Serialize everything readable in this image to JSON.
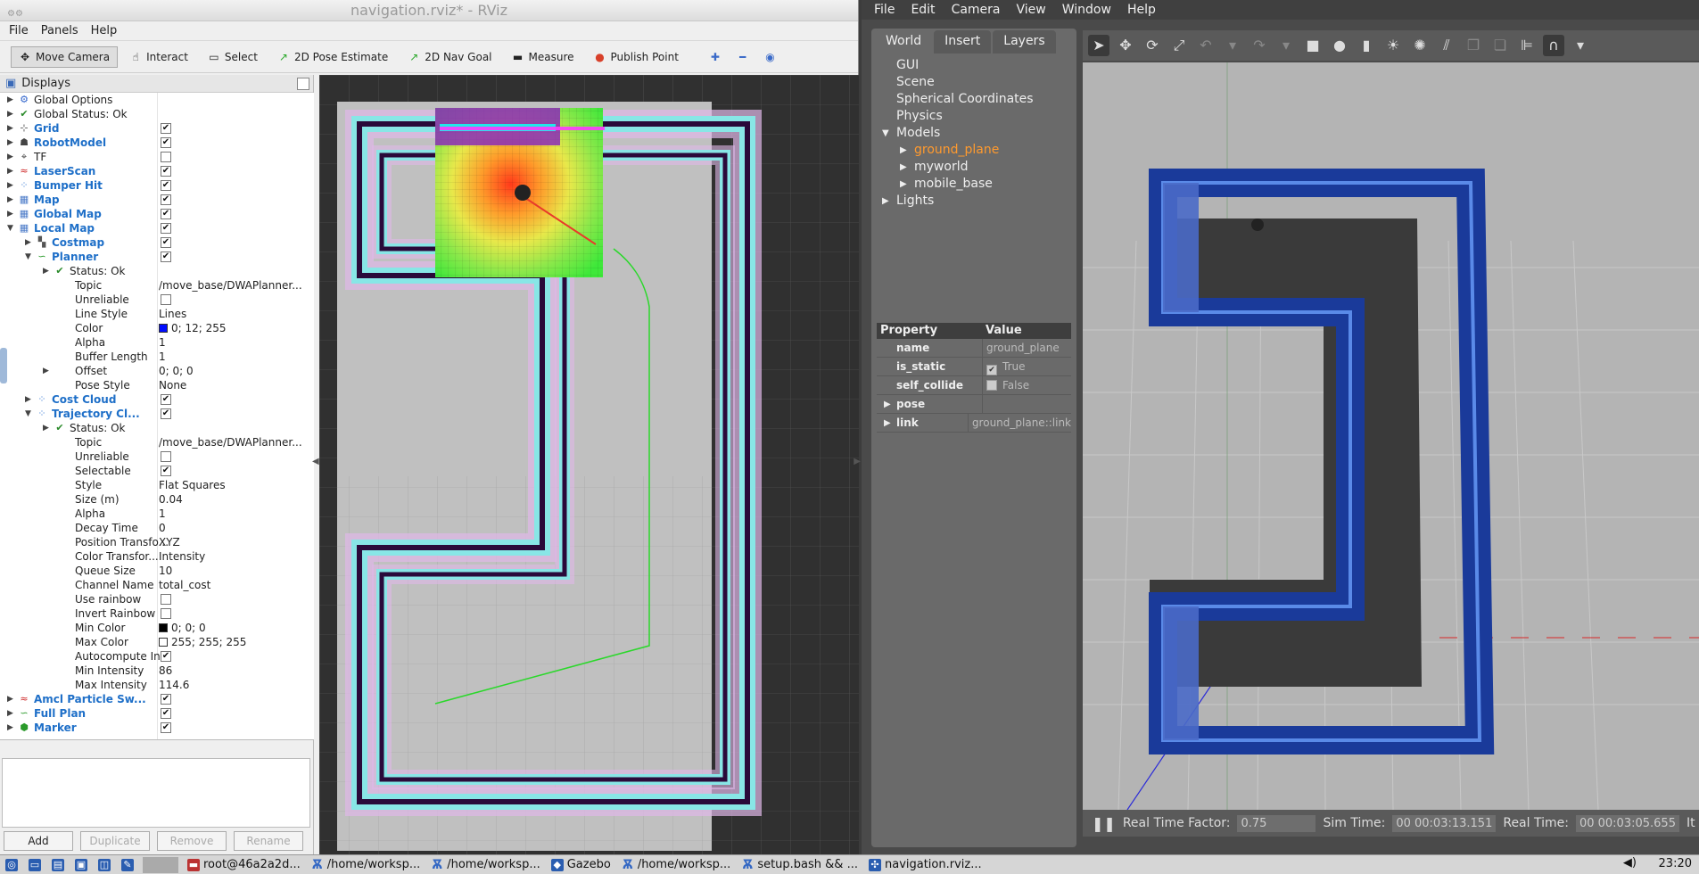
{
  "rviz": {
    "title": "navigation.rviz* - RViz",
    "menu": [
      "File",
      "Panels",
      "Help"
    ],
    "tools": [
      {
        "label": "Move Camera",
        "icon": "move-camera-icon",
        "glyph": "✥"
      },
      {
        "label": "Interact",
        "icon": "hand-icon",
        "glyph": "☝"
      },
      {
        "label": "Select",
        "icon": "select-icon",
        "glyph": "▭"
      },
      {
        "label": "2D Pose Estimate",
        "icon": "pose-arrow-icon",
        "glyph": "↗"
      },
      {
        "label": "2D Nav Goal",
        "icon": "goal-arrow-icon",
        "glyph": "↗"
      },
      {
        "label": "Measure",
        "icon": "ruler-icon",
        "glyph": "▬"
      },
      {
        "label": "Publish Point",
        "icon": "pin-icon",
        "glyph": "●"
      }
    ],
    "displays_title": "Displays",
    "tree": [
      {
        "indent": 0,
        "arrow": "▶",
        "icon": "⚙",
        "iconColor": "#3366cc",
        "name": "Global Options",
        "top": false
      },
      {
        "indent": 0,
        "arrow": "▶",
        "icon": "✔",
        "iconColor": "#2a8a2a",
        "name": "Global Status: Ok",
        "top": false
      },
      {
        "indent": 0,
        "arrow": "▶",
        "icon": "⊹",
        "iconColor": "#555",
        "name": "Grid",
        "top": true,
        "check": "✔"
      },
      {
        "indent": 0,
        "arrow": "▶",
        "icon": "☗",
        "iconColor": "#444",
        "name": "RobotModel",
        "top": true,
        "check": "✔"
      },
      {
        "indent": 0,
        "arrow": "▶",
        "icon": "⌖",
        "iconColor": "#444",
        "name": "TF",
        "top": false,
        "check": ""
      },
      {
        "indent": 0,
        "arrow": "▶",
        "icon": "≈",
        "iconColor": "#c22",
        "name": "LaserScan",
        "top": true,
        "check": "✔"
      },
      {
        "indent": 0,
        "arrow": "▶",
        "icon": "⁘",
        "iconColor": "#3a7bd5",
        "name": "Bumper Hit",
        "top": true,
        "check": "✔"
      },
      {
        "indent": 0,
        "arrow": "▶",
        "icon": "▦",
        "iconColor": "#4a7ac8",
        "name": "Map",
        "top": true,
        "check": "✔"
      },
      {
        "indent": 0,
        "arrow": "▶",
        "icon": "▦",
        "iconColor": "#4a7ac8",
        "name": "Global Map",
        "top": true,
        "check": "✔"
      },
      {
        "indent": 0,
        "arrow": "▼",
        "icon": "▦",
        "iconColor": "#4a7ac8",
        "name": "Local Map",
        "top": true,
        "check": "✔"
      },
      {
        "indent": 1,
        "arrow": "▶",
        "icon": "▚",
        "iconColor": "#555",
        "name": "Costmap",
        "top": true,
        "check": "✔"
      },
      {
        "indent": 1,
        "arrow": "▼",
        "icon": "∽",
        "iconColor": "#2a9a2a",
        "name": "Planner",
        "top": true,
        "check": "✔"
      },
      {
        "indent": 2,
        "arrow": "▶",
        "icon": "✔",
        "iconColor": "#2a8a2a",
        "name": "Status: Ok",
        "top": false
      },
      {
        "indent": 2,
        "arrow": "",
        "icon": "",
        "name": "Topic",
        "top": false,
        "value": "/move_base/DWAPlanner..."
      },
      {
        "indent": 2,
        "arrow": "",
        "icon": "",
        "name": "Unreliable",
        "top": false,
        "check": ""
      },
      {
        "indent": 2,
        "arrow": "",
        "icon": "",
        "name": "Line Style",
        "top": false,
        "value": "Lines"
      },
      {
        "indent": 2,
        "arrow": "",
        "icon": "",
        "name": "Color",
        "top": false,
        "value": "0; 12; 255",
        "swatch": "#000cff"
      },
      {
        "indent": 2,
        "arrow": "",
        "icon": "",
        "name": "Alpha",
        "top": false,
        "value": "1"
      },
      {
        "indent": 2,
        "arrow": "",
        "icon": "",
        "name": "Buffer Length",
        "top": false,
        "value": "1"
      },
      {
        "indent": 2,
        "arrow": "▶",
        "icon": "",
        "name": "Offset",
        "top": false,
        "value": "0; 0; 0"
      },
      {
        "indent": 2,
        "arrow": "",
        "icon": "",
        "name": "Pose Style",
        "top": false,
        "value": "None"
      },
      {
        "indent": 1,
        "arrow": "▶",
        "icon": "⁘",
        "iconColor": "#3a7bd5",
        "name": "Cost Cloud",
        "top": true,
        "check": "✔"
      },
      {
        "indent": 1,
        "arrow": "▼",
        "icon": "⁘",
        "iconColor": "#3a7bd5",
        "name": "Trajectory Cl...",
        "top": true,
        "check": "✔"
      },
      {
        "indent": 2,
        "arrow": "▶",
        "icon": "✔",
        "iconColor": "#2a8a2a",
        "name": "Status: Ok",
        "top": false
      },
      {
        "indent": 2,
        "arrow": "",
        "icon": "",
        "name": "Topic",
        "top": false,
        "value": "/move_base/DWAPlanner..."
      },
      {
        "indent": 2,
        "arrow": "",
        "icon": "",
        "name": "Unreliable",
        "top": false,
        "check": ""
      },
      {
        "indent": 2,
        "arrow": "",
        "icon": "",
        "name": "Selectable",
        "top": false,
        "check": "✔"
      },
      {
        "indent": 2,
        "arrow": "",
        "icon": "",
        "name": "Style",
        "top": false,
        "value": "Flat Squares"
      },
      {
        "indent": 2,
        "arrow": "",
        "icon": "",
        "name": "Size (m)",
        "top": false,
        "value": "0.04"
      },
      {
        "indent": 2,
        "arrow": "",
        "icon": "",
        "name": "Alpha",
        "top": false,
        "value": "1"
      },
      {
        "indent": 2,
        "arrow": "",
        "icon": "",
        "name": "Decay Time",
        "top": false,
        "value": "0"
      },
      {
        "indent": 2,
        "arrow": "",
        "icon": "",
        "name": "Position Transfo...",
        "top": false,
        "value": "XYZ"
      },
      {
        "indent": 2,
        "arrow": "",
        "icon": "",
        "name": "Color Transfor...",
        "top": false,
        "value": "Intensity"
      },
      {
        "indent": 2,
        "arrow": "",
        "icon": "",
        "name": "Queue Size",
        "top": false,
        "value": "10"
      },
      {
        "indent": 2,
        "arrow": "",
        "icon": "",
        "name": "Channel Name",
        "top": false,
        "value": "total_cost"
      },
      {
        "indent": 2,
        "arrow": "",
        "icon": "",
        "name": "Use rainbow",
        "top": false,
        "check": ""
      },
      {
        "indent": 2,
        "arrow": "",
        "icon": "",
        "name": "Invert Rainbow",
        "top": false,
        "check": ""
      },
      {
        "indent": 2,
        "arrow": "",
        "icon": "",
        "name": "Min Color",
        "top": false,
        "value": "0; 0; 0",
        "swatch": "#000000"
      },
      {
        "indent": 2,
        "arrow": "",
        "icon": "",
        "name": "Max Color",
        "top": false,
        "value": "255; 255; 255",
        "swatch": "#ffffff"
      },
      {
        "indent": 2,
        "arrow": "",
        "icon": "",
        "name": "Autocompute In...",
        "top": false,
        "check": "✔"
      },
      {
        "indent": 2,
        "arrow": "",
        "icon": "",
        "name": "Min Intensity",
        "top": false,
        "value": "86"
      },
      {
        "indent": 2,
        "arrow": "",
        "icon": "",
        "name": "Max Intensity",
        "top": false,
        "value": "114.6"
      },
      {
        "indent": 0,
        "arrow": "▶",
        "icon": "≈",
        "iconColor": "#c22",
        "name": "Amcl Particle Sw...",
        "top": true,
        "check": "✔"
      },
      {
        "indent": 0,
        "arrow": "▶",
        "icon": "∽",
        "iconColor": "#2a9a2a",
        "name": "Full Plan",
        "top": true,
        "check": "✔"
      },
      {
        "indent": 0,
        "arrow": "▶",
        "icon": "⬢",
        "iconColor": "#2a9a2a",
        "name": "Marker",
        "top": true,
        "check": "✔"
      }
    ],
    "buttons": {
      "add": "Add",
      "duplicate": "Duplicate",
      "remove": "Remove",
      "rename": "Rename"
    }
  },
  "gazebo": {
    "menu": [
      "File",
      "Edit",
      "Camera",
      "View",
      "Window",
      "Help"
    ],
    "tabs": [
      "World",
      "Insert",
      "Layers"
    ],
    "tree": [
      {
        "indent": 0,
        "arrow": "",
        "label": "GUI",
        "selected": false
      },
      {
        "indent": 0,
        "arrow": "",
        "label": "Scene",
        "selected": false
      },
      {
        "indent": 0,
        "arrow": "",
        "label": "Spherical Coordinates",
        "selected": false
      },
      {
        "indent": 0,
        "arrow": "",
        "label": "Physics",
        "selected": false
      },
      {
        "indent": 0,
        "arrow": "▼",
        "label": "Models",
        "selected": false
      },
      {
        "indent": 1,
        "arrow": "▶",
        "label": "ground_plane",
        "selected": true
      },
      {
        "indent": 1,
        "arrow": "▶",
        "label": "myworld",
        "selected": false
      },
      {
        "indent": 1,
        "arrow": "▶",
        "label": "mobile_base",
        "selected": false
      },
      {
        "indent": 0,
        "arrow": "▶",
        "label": "Lights",
        "selected": false
      }
    ],
    "props_header": {
      "property": "Property",
      "value": "Value"
    },
    "props": [
      {
        "key": "name",
        "value": "ground_plane",
        "arrow": "",
        "check": null
      },
      {
        "key": "is_static",
        "value": "True",
        "arrow": "",
        "check": "✔"
      },
      {
        "key": "self_collide",
        "value": "False",
        "arrow": "",
        "check": ""
      },
      {
        "key": "pose",
        "value": "",
        "arrow": "▶",
        "check": null
      },
      {
        "key": "link",
        "value": "ground_plane::link",
        "arrow": "▶",
        "check": null
      }
    ],
    "status": {
      "rtf_label": "Real Time Factor:",
      "rtf": "0.75",
      "sim_label": "Sim Time:",
      "sim": "00 00:03:13.151",
      "real_label": "Real Time:",
      "real": "00 00:03:05.655",
      "trail": "It"
    }
  },
  "taskbar": {
    "items": [
      {
        "label": "root@46a2a2d...",
        "icon": "terminal-icon",
        "glyph": "▬",
        "red": true
      },
      {
        "label": "/home/worksp...",
        "icon": "rviz-icon",
        "glyph": "Ѫ",
        "rviz": true
      },
      {
        "label": "/home/worksp...",
        "icon": "rviz-icon",
        "glyph": "Ѫ",
        "rviz": true
      },
      {
        "label": "Gazebo",
        "icon": "gazebo-icon",
        "glyph": "◆"
      },
      {
        "label": "/home/worksp...",
        "icon": "rviz-icon",
        "glyph": "Ѫ",
        "rviz": true
      },
      {
        "label": "setup.bash && ...",
        "icon": "rviz-icon",
        "glyph": "Ѫ",
        "rviz": true
      },
      {
        "label": "navigation.rviz...",
        "icon": "rviz-window-icon",
        "glyph": "✣"
      }
    ],
    "clock": "23:20"
  }
}
